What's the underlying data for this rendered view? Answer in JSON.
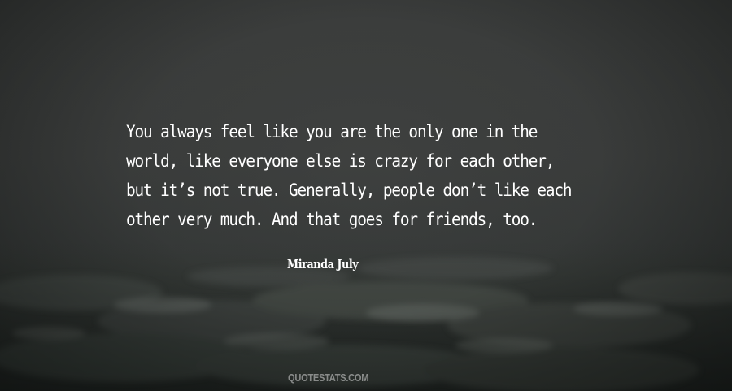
{
  "quote": {
    "lines": [
      "You always feel like you are the only one in the",
      "world, like everyone else is crazy for each other,",
      "but it’s not true. Generally, people don’t like each",
      "other very much. And that goes for friends, too."
    ]
  },
  "author": "Miranda July",
  "watermark": "QUOTESTATS.COM",
  "colors": {
    "text": "#ffffff",
    "background": "#3a3d3c",
    "sea": "#2a2f2c"
  }
}
